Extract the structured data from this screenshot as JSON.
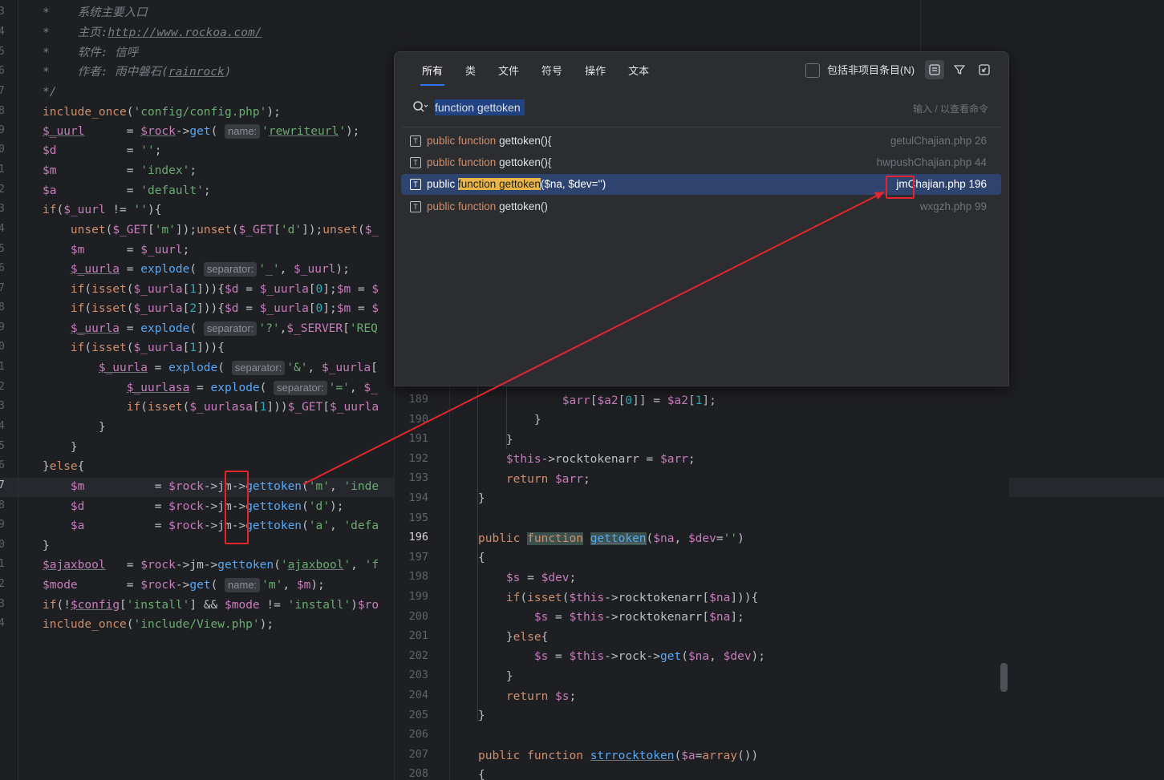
{
  "left_editor": {
    "line_numbers": [
      "3",
      "4",
      "5",
      "6",
      "7",
      "8",
      "9",
      "0",
      "1",
      "2",
      "3",
      "4",
      "5",
      "6",
      "7",
      "8",
      "9",
      "0",
      "1",
      "2",
      "3",
      "4",
      "5",
      "6",
      "7",
      "8",
      "9",
      "0",
      "1",
      "2",
      "3",
      "4"
    ],
    "current_line_number": "7",
    "comment": {
      "line1_prefix": "*",
      "line1_text": "系统主要入口",
      "line2_prefix": "*",
      "line2_label": "主页:",
      "line2_url": "http://www.rockoa.com/",
      "line3_prefix": "*",
      "line3_text": "软件: 信呼",
      "line4_prefix": "*",
      "line4_label": "作者: 雨中磐石(",
      "line4_link": "rainrock",
      "line4_close": ")",
      "line5": "*/"
    },
    "hints": {
      "name": "name:",
      "separator": "separator:"
    }
  },
  "search_popup": {
    "tabs": [
      "所有",
      "类",
      "文件",
      "符号",
      "操作",
      "文本"
    ],
    "active_tab": "所有",
    "include_label": "包括非项目条目(N)",
    "query": "function gettoken",
    "hint": "输入 / 以查看命令",
    "results": [
      {
        "kw": "public function",
        "name": " gettoken(){",
        "file": "getulChajian.php 26",
        "selected": false
      },
      {
        "kw": "public function",
        "name": " gettoken(){",
        "file": "hwpushChajian.php 44",
        "selected": false
      },
      {
        "kw": "public ",
        "match": "function gettoken",
        "name": "($na, $dev='')",
        "file": "jmChajian.php 196",
        "selected": true
      },
      {
        "kw": "public function",
        "name": " gettoken()",
        "file": "wxgzh.php 99",
        "selected": false
      }
    ]
  },
  "right_editor": {
    "line_numbers": [
      "189",
      "190",
      "191",
      "192",
      "193",
      "194",
      "195",
      "196",
      "197",
      "198",
      "199",
      "200",
      "201",
      "202",
      "203",
      "204",
      "205",
      "206",
      "207",
      "208"
    ],
    "current_line_number": "196"
  },
  "colors": {
    "background": "#1e1f22",
    "popup": "#2b2d30",
    "selection": "#2e436e",
    "annotation": "#e3262b"
  }
}
